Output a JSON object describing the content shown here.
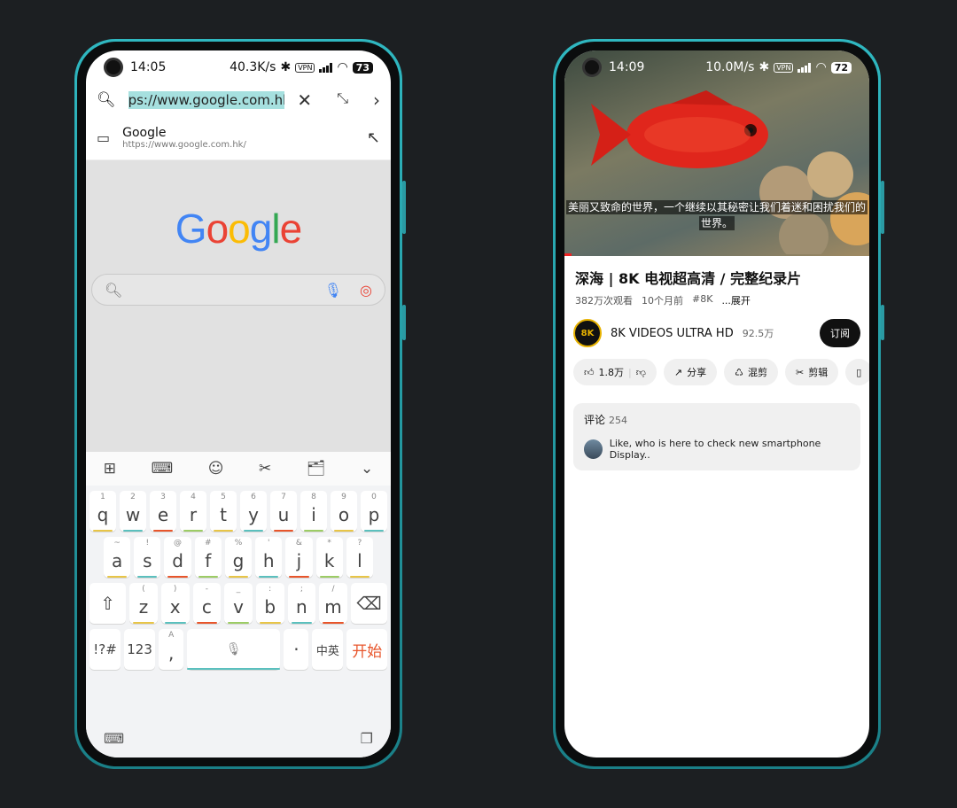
{
  "left": {
    "status": {
      "time": "14:05",
      "speed": "40.3K/s",
      "vpn": "VPN",
      "battery": "73"
    },
    "url": {
      "text": "ps://www.google.com.hk/"
    },
    "suggestion": {
      "title": "Google",
      "url": "https://www.google.com.hk/"
    },
    "google": {
      "logo_letters": [
        "G",
        "o",
        "o",
        "g",
        "l",
        "e"
      ],
      "logo_colors": [
        "#4285F4",
        "#EA4335",
        "#FBBC05",
        "#4285F4",
        "#34A853",
        "#EA4335"
      ]
    },
    "keyboard": {
      "row1": [
        [
          "1",
          "q"
        ],
        [
          "2",
          "w"
        ],
        [
          "3",
          "e"
        ],
        [
          "4",
          "r"
        ],
        [
          "5",
          "t"
        ],
        [
          "6",
          "y"
        ],
        [
          "7",
          "u"
        ],
        [
          "8",
          "i"
        ],
        [
          "9",
          "o"
        ],
        [
          "0",
          "p"
        ]
      ],
      "row2": [
        [
          "~",
          "a"
        ],
        [
          "!",
          "s"
        ],
        [
          "@",
          "d"
        ],
        [
          "#",
          "f"
        ],
        [
          "%",
          "g"
        ],
        [
          "'",
          "h"
        ],
        [
          "&",
          "j"
        ],
        [
          "*",
          "k"
        ],
        [
          "?",
          "l"
        ]
      ],
      "row3": [
        [
          "(",
          "z"
        ],
        [
          ")",
          "x"
        ],
        [
          "-",
          "c"
        ],
        [
          "_",
          "v"
        ],
        [
          ":",
          "b"
        ],
        [
          ";",
          "n"
        ],
        [
          "/",
          "m"
        ]
      ],
      "row4": {
        "sym": "!?#",
        "num": "123",
        "comma_sub": "A",
        "comma": ",",
        "dot": "·",
        "lang": "中英",
        "go": "开始"
      }
    }
  },
  "right": {
    "status": {
      "time": "14:09",
      "speed": "10.0M/s",
      "vpn": "VPN",
      "battery": "72"
    },
    "caption_line1": "美丽又致命的世界，一个继续以其秘密让我们着迷和困扰我们的",
    "caption_line2": "世界。",
    "title": "深海 | 8K 电视超高清 / 完整纪录片",
    "views": "382万次观看",
    "age": "10个月前",
    "tag": "#8K",
    "more": "...展开",
    "channel": {
      "avatar_text": "8K",
      "name": "8K VIDEOS ULTRA HD",
      "subs": "92.5万",
      "subscribe": "订阅"
    },
    "actions": {
      "likes": "1.8万",
      "share": "分享",
      "remix": "混剪",
      "clip": "剪辑"
    },
    "comments": {
      "label": "评论",
      "count": "254",
      "first": "Like, who is here to check new smartphone Display.."
    }
  }
}
